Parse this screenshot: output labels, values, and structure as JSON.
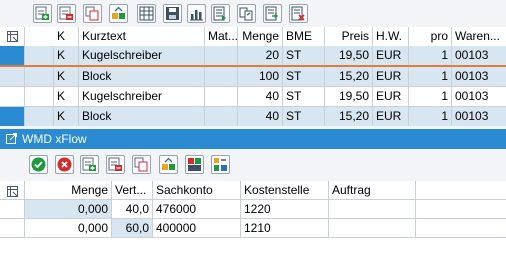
{
  "toolbar_top": {
    "buttons": [
      {
        "icon": "insert-row-icon"
      },
      {
        "icon": "delete-row-icon"
      },
      {
        "icon": "copy-icon"
      },
      {
        "icon": "move-icon"
      },
      {
        "icon": "table-icon"
      },
      {
        "icon": "save-icon"
      },
      {
        "icon": "chart-icon"
      },
      {
        "icon": "import-icon"
      },
      {
        "icon": "transfer-icon"
      },
      {
        "icon": "export-icon"
      },
      {
        "icon": "delete-document-icon"
      }
    ]
  },
  "grid1": {
    "columns": [
      "K",
      "Kurztext",
      "Mat...",
      "Menge",
      "BME",
      "Preis",
      "H.W.",
      "pro",
      "Waren..."
    ],
    "rows": [
      {
        "k": "K",
        "kurztext": "Kugelschreiber",
        "mat": "",
        "menge": "20",
        "bme": "ST",
        "preis": "19,50",
        "hw": "EUR",
        "pro": "1",
        "waren": "00103",
        "selected": true
      },
      {
        "k": "K",
        "kurztext": "Block",
        "mat": "",
        "menge": "100",
        "bme": "ST",
        "preis": "15,20",
        "hw": "EUR",
        "pro": "1",
        "waren": "00103",
        "selected": false
      },
      {
        "k": "K",
        "kurztext": "Kugelschreiber",
        "mat": "",
        "menge": "40",
        "bme": "ST",
        "preis": "19,50",
        "hw": "EUR",
        "pro": "1",
        "waren": "00103",
        "selected": false
      },
      {
        "k": "K",
        "kurztext": "Block",
        "mat": "",
        "menge": "40",
        "bme": "ST",
        "preis": "15,20",
        "hw": "EUR",
        "pro": "1",
        "waren": "00103",
        "selected": true
      }
    ]
  },
  "panel": {
    "title": "WMD xFlow"
  },
  "toolbar_bottom": {
    "buttons": [
      {
        "icon": "check-icon"
      },
      {
        "icon": "cancel-icon"
      },
      {
        "icon": "insert-row-icon"
      },
      {
        "icon": "delete-row-icon"
      },
      {
        "icon": "copy-icon"
      },
      {
        "icon": "move-icon"
      },
      {
        "icon": "layout-icon"
      },
      {
        "icon": "distribute-icon"
      }
    ]
  },
  "grid2": {
    "columns": [
      "Menge",
      "Vert...",
      "Sachkonto",
      "Kostenstelle",
      "Auftrag"
    ],
    "rows": [
      {
        "menge": "0,000",
        "vert": "40,0",
        "sachkonto": "476000",
        "kostenstelle": "1220",
        "auftrag": ""
      },
      {
        "menge": "0,000",
        "vert": "60,0",
        "sachkonto": "400000",
        "kostenstelle": "1210",
        "auftrag": ""
      }
    ]
  },
  "colors": {
    "accent": "#2a8ad2",
    "row_selected": "#d8e6f2",
    "row_marker": "#2a8ad2",
    "row_divider": "#e07b39"
  }
}
